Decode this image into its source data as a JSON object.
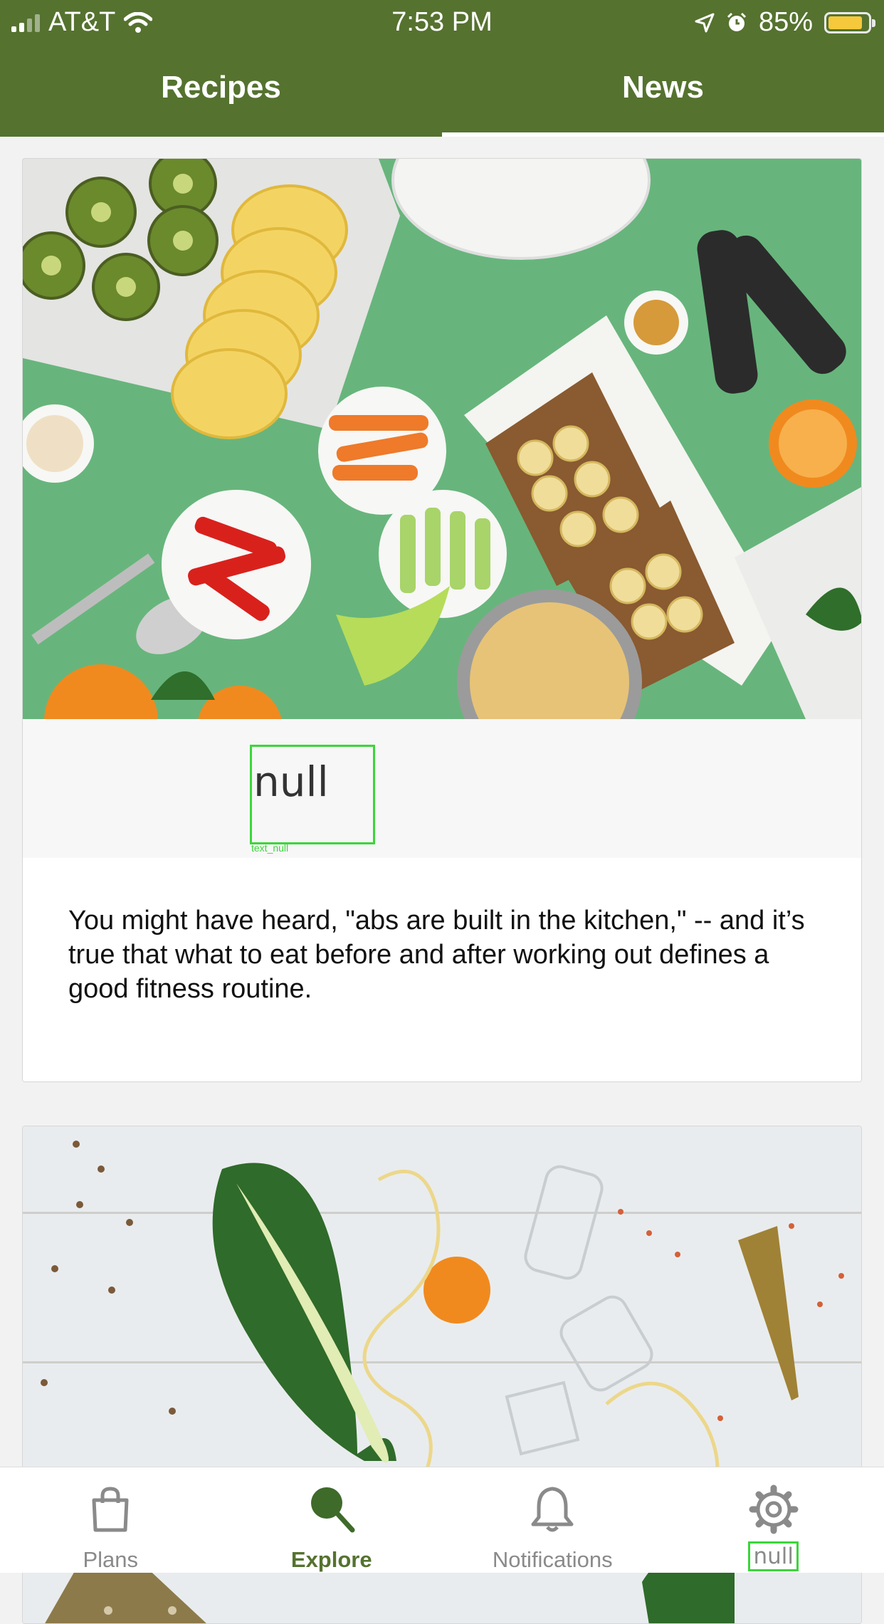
{
  "status_bar": {
    "carrier": "AT&T",
    "time": "7:53 PM",
    "battery_percent": "85%",
    "battery_level": 0.85,
    "icons": [
      "signal-icon",
      "wifi-icon",
      "location-arrow-icon",
      "alarm-icon",
      "battery-icon"
    ]
  },
  "tabs": [
    {
      "label": "Recipes",
      "active": false
    },
    {
      "label": "News",
      "active": true
    }
  ],
  "colors": {
    "brand": "#55722f",
    "debug_outline": "#3bd63b"
  },
  "cards": [
    {
      "image": "fitness-foods-photo",
      "title": "null",
      "title_debug_tag": "text_null",
      "text": "You might have heard, \"abs are built in the kitchen,\" -- and it’s true that what to eat before and after working out defines a good fitness routine."
    },
    {
      "image": "party-vegetables-photo"
    }
  ],
  "bottom_nav": [
    {
      "label": "Plans",
      "icon": "shopping-bag-icon",
      "active": false
    },
    {
      "label": "Explore",
      "icon": "search-icon",
      "active": true
    },
    {
      "label": "Notifications",
      "icon": "bell-icon",
      "active": false
    },
    {
      "label": "null",
      "icon": "gear-icon",
      "active": false
    }
  ]
}
